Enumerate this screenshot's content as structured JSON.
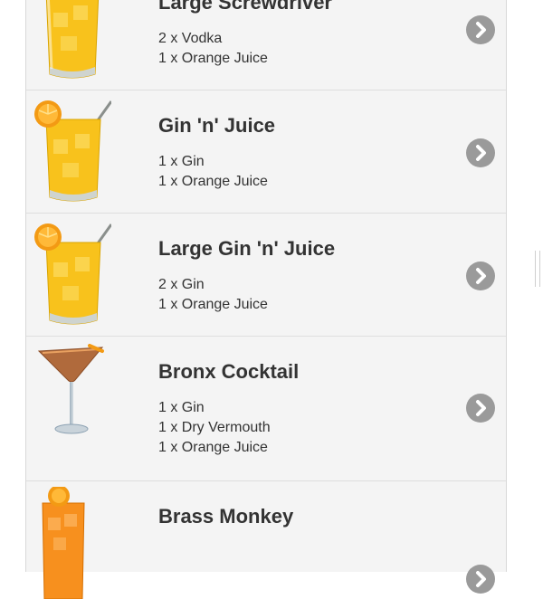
{
  "drinks": [
    {
      "name": "Large Screwdriver",
      "ingredients": [
        "2 x Vodka",
        "1 x Orange Juice"
      ],
      "icon": "orange-drink-glass-icon"
    },
    {
      "name": "Gin 'n' Juice",
      "ingredients": [
        "1 x Gin",
        "1 x Orange Juice"
      ],
      "icon": "orange-drink-glass-straw-icon"
    },
    {
      "name": "Large Gin 'n' Juice",
      "ingredients": [
        "2 x Gin",
        "1 x Orange Juice"
      ],
      "icon": "orange-drink-glass-straw-icon"
    },
    {
      "name": "Bronx Cocktail",
      "ingredients": [
        "1 x Gin",
        "1 x Dry Vermouth",
        "1 x Orange Juice"
      ],
      "icon": "martini-glass-icon"
    },
    {
      "name": "Brass Monkey",
      "ingredients": [],
      "icon": "tall-orange-drink-icon"
    }
  ],
  "colors": {
    "row_background": "#f4f4f4",
    "divider": "#dedede",
    "chevron_circle": "#9a9a9a",
    "text": "#333333"
  }
}
